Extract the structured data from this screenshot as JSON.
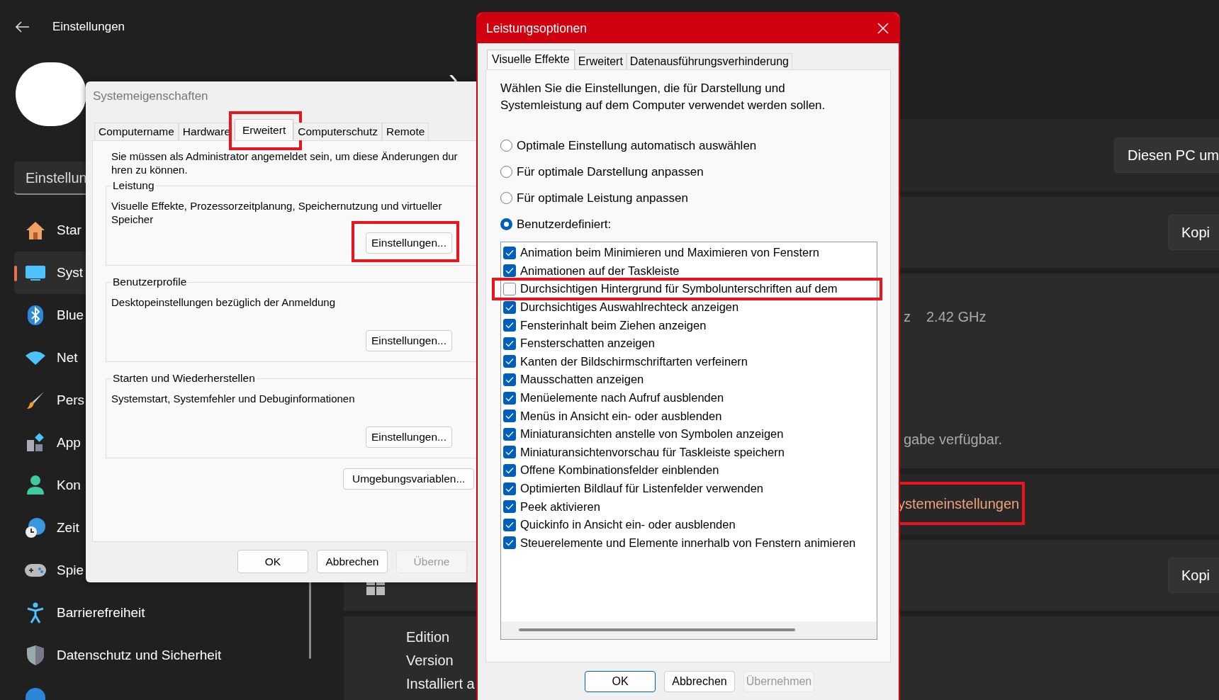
{
  "settings": {
    "title": "Einstellungen",
    "search": {
      "value": "Einstellun"
    },
    "nav": [
      {
        "label": "Star",
        "selected": false
      },
      {
        "label": "Syst",
        "selected": true
      },
      {
        "label": "Blue",
        "selected": false
      },
      {
        "label": "Net",
        "selected": false
      },
      {
        "label": "Pers",
        "selected": false
      },
      {
        "label": "App",
        "selected": false
      },
      {
        "label": "Kon",
        "selected": false
      },
      {
        "label": "Zeit",
        "selected": false
      },
      {
        "label": "Spie",
        "selected": false
      },
      {
        "label": "Barrierefreiheit",
        "selected": false
      },
      {
        "label": "Datenschutz und Sicherheit",
        "selected": false
      },
      {
        "selected": false
      }
    ],
    "heading_chevron": "›",
    "rename_button": "Diesen PC um",
    "copy_buttons": [
      "Kopi",
      "Kopi"
    ],
    "processor_tail": "z",
    "processor_speed": "2.42 GHz",
    "pen_touch_note": "gabe verfügbar.",
    "advanced_link": {
      "label": "ystemeinstellungen",
      "highlighted": true
    },
    "specs_labels": [
      "Edition",
      "Version",
      "Installiert a"
    ]
  },
  "system_properties": {
    "title": "Systemeigenschaften",
    "tabs": [
      {
        "label": "Computername",
        "selected": false,
        "highlighted": false
      },
      {
        "label": "Hardware",
        "selected": false,
        "highlighted": false
      },
      {
        "label": "Erweitert",
        "selected": true,
        "highlighted": true
      },
      {
        "label": "Computerschutz",
        "selected": false,
        "highlighted": false
      },
      {
        "label": "Remote",
        "selected": false,
        "highlighted": false
      }
    ],
    "admin_note_lines": [
      "Sie müssen als Administrator angemeldet sein, um diese Änderungen dur",
      "hren zu können."
    ],
    "groups": [
      {
        "title": "Leistung",
        "description": "Visuelle Effekte, Prozessorzeitplanung, Speichernutzung und virtueller Speicher",
        "button": {
          "label": "Einstellungen...",
          "highlighted": true
        }
      },
      {
        "title": "Benutzerprofile",
        "description": "Desktopeinstellungen bezüglich der Anmeldung",
        "button": {
          "label": "Einstellungen...",
          "highlighted": false
        }
      },
      {
        "title": "Starten und Wiederherstellen",
        "description": "Systemstart, Systemfehler und Debuginformationen",
        "button": {
          "label": "Einstellungen...",
          "highlighted": false
        }
      }
    ],
    "env_button": "Umgebungsvariablen...",
    "buttons": [
      {
        "label": "OK",
        "disabled": false
      },
      {
        "label": "Abbrechen",
        "disabled": false
      },
      {
        "label": "Überne",
        "disabled": true
      }
    ]
  },
  "performance_options": {
    "title": "Leistungsoptionen",
    "tabs": [
      {
        "label": "Visuelle Effekte",
        "selected": true
      },
      {
        "label": "Erweitert",
        "selected": false
      },
      {
        "label": "Datenausführungsverhinderung",
        "selected": false
      }
    ],
    "intro": "Wählen Sie die Einstellungen, die für Darstellung und Systemleistung auf dem Computer verwendet werden sollen.",
    "modes": [
      {
        "label": "Optimale Einstellung automatisch auswählen",
        "selected": false
      },
      {
        "label": "Für optimale Darstellung anpassen",
        "selected": false
      },
      {
        "label": "Für optimale Leistung anpassen",
        "selected": false
      },
      {
        "label": "Benutzerdefiniert:",
        "selected": true
      }
    ],
    "effects": [
      {
        "label": "Animation beim Minimieren und Maximieren von Fenstern",
        "checked": true,
        "highlighted": false
      },
      {
        "label": "Animationen auf der Taskleiste",
        "checked": true,
        "highlighted": false
      },
      {
        "label": "Durchsichtigen Hintergrund für Symbolunterschriften auf dem",
        "checked": false,
        "highlighted": true
      },
      {
        "label": "Durchsichtiges Auswahlrechteck anzeigen",
        "checked": true,
        "highlighted": false
      },
      {
        "label": "Fensterinhalt beim Ziehen anzeigen",
        "checked": true,
        "highlighted": false
      },
      {
        "label": "Fensterschatten anzeigen",
        "checked": true,
        "highlighted": false
      },
      {
        "label": "Kanten der Bildschirmschriftarten verfeinern",
        "checked": true,
        "highlighted": false
      },
      {
        "label": "Mausschatten anzeigen",
        "checked": true,
        "highlighted": false
      },
      {
        "label": "Menüelemente nach Aufruf ausblenden",
        "checked": true,
        "highlighted": false
      },
      {
        "label": "Menüs in Ansicht ein- oder ausblenden",
        "checked": true,
        "highlighted": false
      },
      {
        "label": "Miniaturansichten anstelle von Symbolen anzeigen",
        "checked": true,
        "highlighted": false
      },
      {
        "label": "Miniaturansichtenvorschau für Taskleiste speichern",
        "checked": true,
        "highlighted": false
      },
      {
        "label": "Offene Kombinationsfelder einblenden",
        "checked": true,
        "highlighted": false
      },
      {
        "label": "Optimierten Bildlauf für Listenfelder verwenden",
        "checked": true,
        "highlighted": false
      },
      {
        "label": "Peek aktivieren",
        "checked": true,
        "highlighted": false
      },
      {
        "label": "Quickinfo in Ansicht ein- oder ausblenden",
        "checked": true,
        "highlighted": false
      },
      {
        "label": "Steuerelemente und Elemente innerhalb von Fenstern animieren",
        "checked": true,
        "highlighted": false
      }
    ],
    "buttons": [
      {
        "label": "OK",
        "default": true,
        "disabled": false
      },
      {
        "label": "Abbrechen",
        "default": false,
        "disabled": false
      },
      {
        "label": "Übernehmen",
        "default": false,
        "disabled": true
      }
    ]
  }
}
